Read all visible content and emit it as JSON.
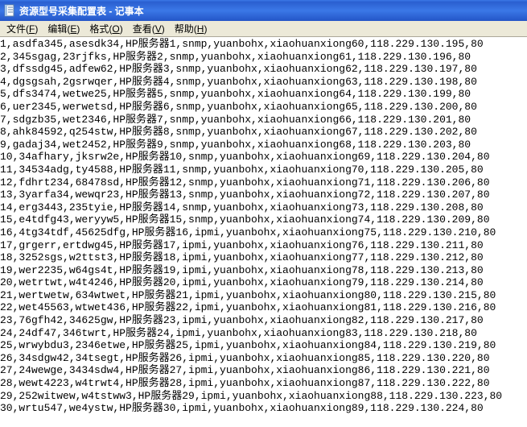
{
  "window": {
    "title": "资源型号采集配置表 - 记事本"
  },
  "menubar": {
    "items": [
      {
        "label": "文件",
        "accel": "F"
      },
      {
        "label": "编辑",
        "accel": "E"
      },
      {
        "label": "格式",
        "accel": "O"
      },
      {
        "label": "查看",
        "accel": "V"
      },
      {
        "label": "帮助",
        "accel": "H"
      }
    ]
  },
  "text_lines": [
    "1,asdfa345,asesdk34,HP服务器1,snmp,yuanbohx,xiaohuanxiong60,118.229.130.195,80",
    "2,345sgag,23rjfks,HP服务器2,snmp,yuanbohx,xiaohuanxiong61,118.229.130.196,80",
    "3,dfssdg45,adfew62,HP服务器3,snmp,yuanbohx,xiaohuanxiong62,118.229.130.197,80",
    "4,dgsgsah,2gsrwqer,HP服务器4,snmp,yuanbohx,xiaohuanxiong63,118.229.130.198,80",
    "5,dfs3474,wetwe25,HP服务器5,snmp,yuanbohx,xiaohuanxiong64,118.229.130.199,80",
    "6,uer2345,werwetsd,HP服务器6,snmp,yuanbohx,xiaohuanxiong65,118.229.130.200,80",
    "7,sdgzb35,wet2346,HP服务器7,snmp,yuanbohx,xiaohuanxiong66,118.229.130.201,80",
    "8,ahk84592,q254stw,HP服务器8,snmp,yuanbohx,xiaohuanxiong67,118.229.130.202,80",
    "9,gadaj34,wet2452,HP服务器9,snmp,yuanbohx,xiaohuanxiong68,118.229.130.203,80",
    "10,34afhary,jksrw2e,HP服务器10,snmp,yuanbohx,xiaohuanxiong69,118.229.130.204,80",
    "11,34534adg,ty4588,HP服务器11,snmp,yuanbohx,xiaohuanxiong70,118.229.130.205,80",
    "12,fdhrt234,68478sd,HP服务器12,snmp,yuanbohx,xiaohuanxiong71,118.229.130.206,80",
    "13,3yarfa34,wewqr23,HP服务器13,snmp,yuanbohx,xiaohuanxiong72,118.229.130.207,80",
    "14,erg3443,235tyie,HP服务器14,snmp,yuanbohx,xiaohuanxiong73,118.229.130.208,80",
    "15,e4tdfg43,weryyw5,HP服务器15,snmp,yuanbohx,xiaohuanxiong74,118.229.130.209,80",
    "16,4tg34tdf,45625dfg,HP服务器16,ipmi,yuanbohx,xiaohuanxiong75,118.229.130.210,80",
    "17,grgerr,ertdwg45,HP服务器17,ipmi,yuanbohx,xiaohuanxiong76,118.229.130.211,80",
    "18,3252sgs,w2ttst3,HP服务器18,ipmi,yuanbohx,xiaohuanxiong77,118.229.130.212,80",
    "19,wer2235,w64gs4t,HP服务器19,ipmi,yuanbohx,xiaohuanxiong78,118.229.130.213,80",
    "20,wetrtwt,w4t4246,HP服务器20,ipmi,yuanbohx,xiaohuanxiong79,118.229.130.214,80",
    "21,wertwetw,634wtwet,HP服务器21,ipmi,yuanbohx,xiaohuanxiong80,118.229.130.215,80",
    "22,wet45563,wtwet436,HP服务器22,ipmi,yuanbohx,xiaohuanxiong81,118.229.130.216,80",
    "23,76gfh42,34625gw,HP服务器23,ipmi,yuanbohx,xiaohuanxiong82,118.229.130.217,80",
    "24,24df47,346twrt,HP服务器24,ipmi,yuanbohx,xiaohuanxiong83,118.229.130.218,80",
    "25,wrwybdu3,2346etwe,HP服务器25,ipmi,yuanbohx,xiaohuanxiong84,118.229.130.219,80",
    "26,34sdgw42,34tsegt,HP服务器26,ipmi,yuanbohx,xiaohuanxiong85,118.229.130.220,80",
    "27,24wewge,3434sdw4,HP服务器27,ipmi,yuanbohx,xiaohuanxiong86,118.229.130.221,80",
    "28,wewt4223,w4trwt4,HP服务器28,ipmi,yuanbohx,xiaohuanxiong87,118.229.130.222,80",
    "29,252witwew,w4tstww3,HP服务器29,ipmi,yuanbohx,xiaohuanxiong88,118.229.130.223,80",
    "30,wrtu547,we4ystw,HP服务器30,ipmi,yuanbohx,xiaohuanxiong89,118.229.130.224,80"
  ]
}
